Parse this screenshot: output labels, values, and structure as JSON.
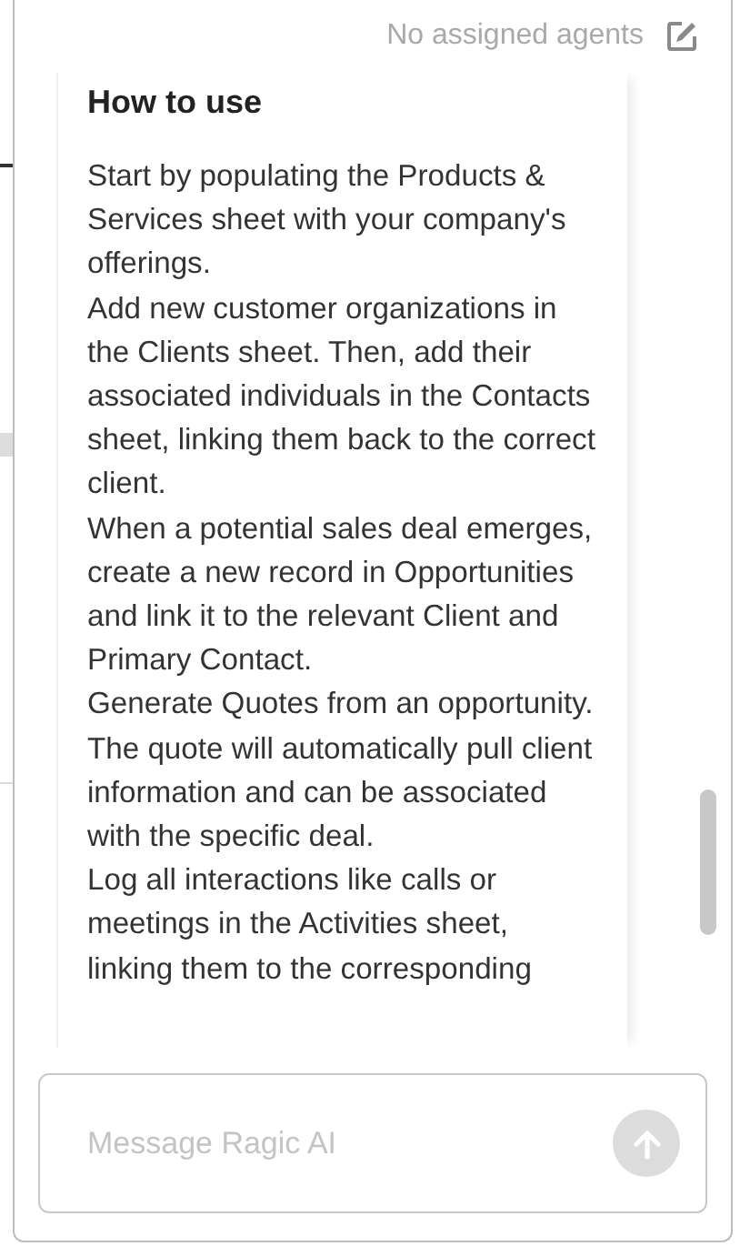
{
  "header": {
    "status": "No assigned agents"
  },
  "card": {
    "title": "How to use",
    "paragraphs": [
      "Start by populating the Products & Services sheet with your company's offerings.",
      "Add new customer organizations in the Clients sheet. Then, add their associated individuals in the Contacts sheet, linking them back to the correct client.",
      "When a potential sales deal emerges, create a new record in Opportunities and link it to the relevant Client and Primary Contact.",
      "Generate Quotes from an opportunity. The quote will automatically pull client information and can be associated with the specific deal.",
      "Log all interactions like calls or meetings in the Activities sheet, linking them to the corresponding"
    ]
  },
  "composer": {
    "placeholder": "Message Ragic AI",
    "send_disabled": true
  }
}
